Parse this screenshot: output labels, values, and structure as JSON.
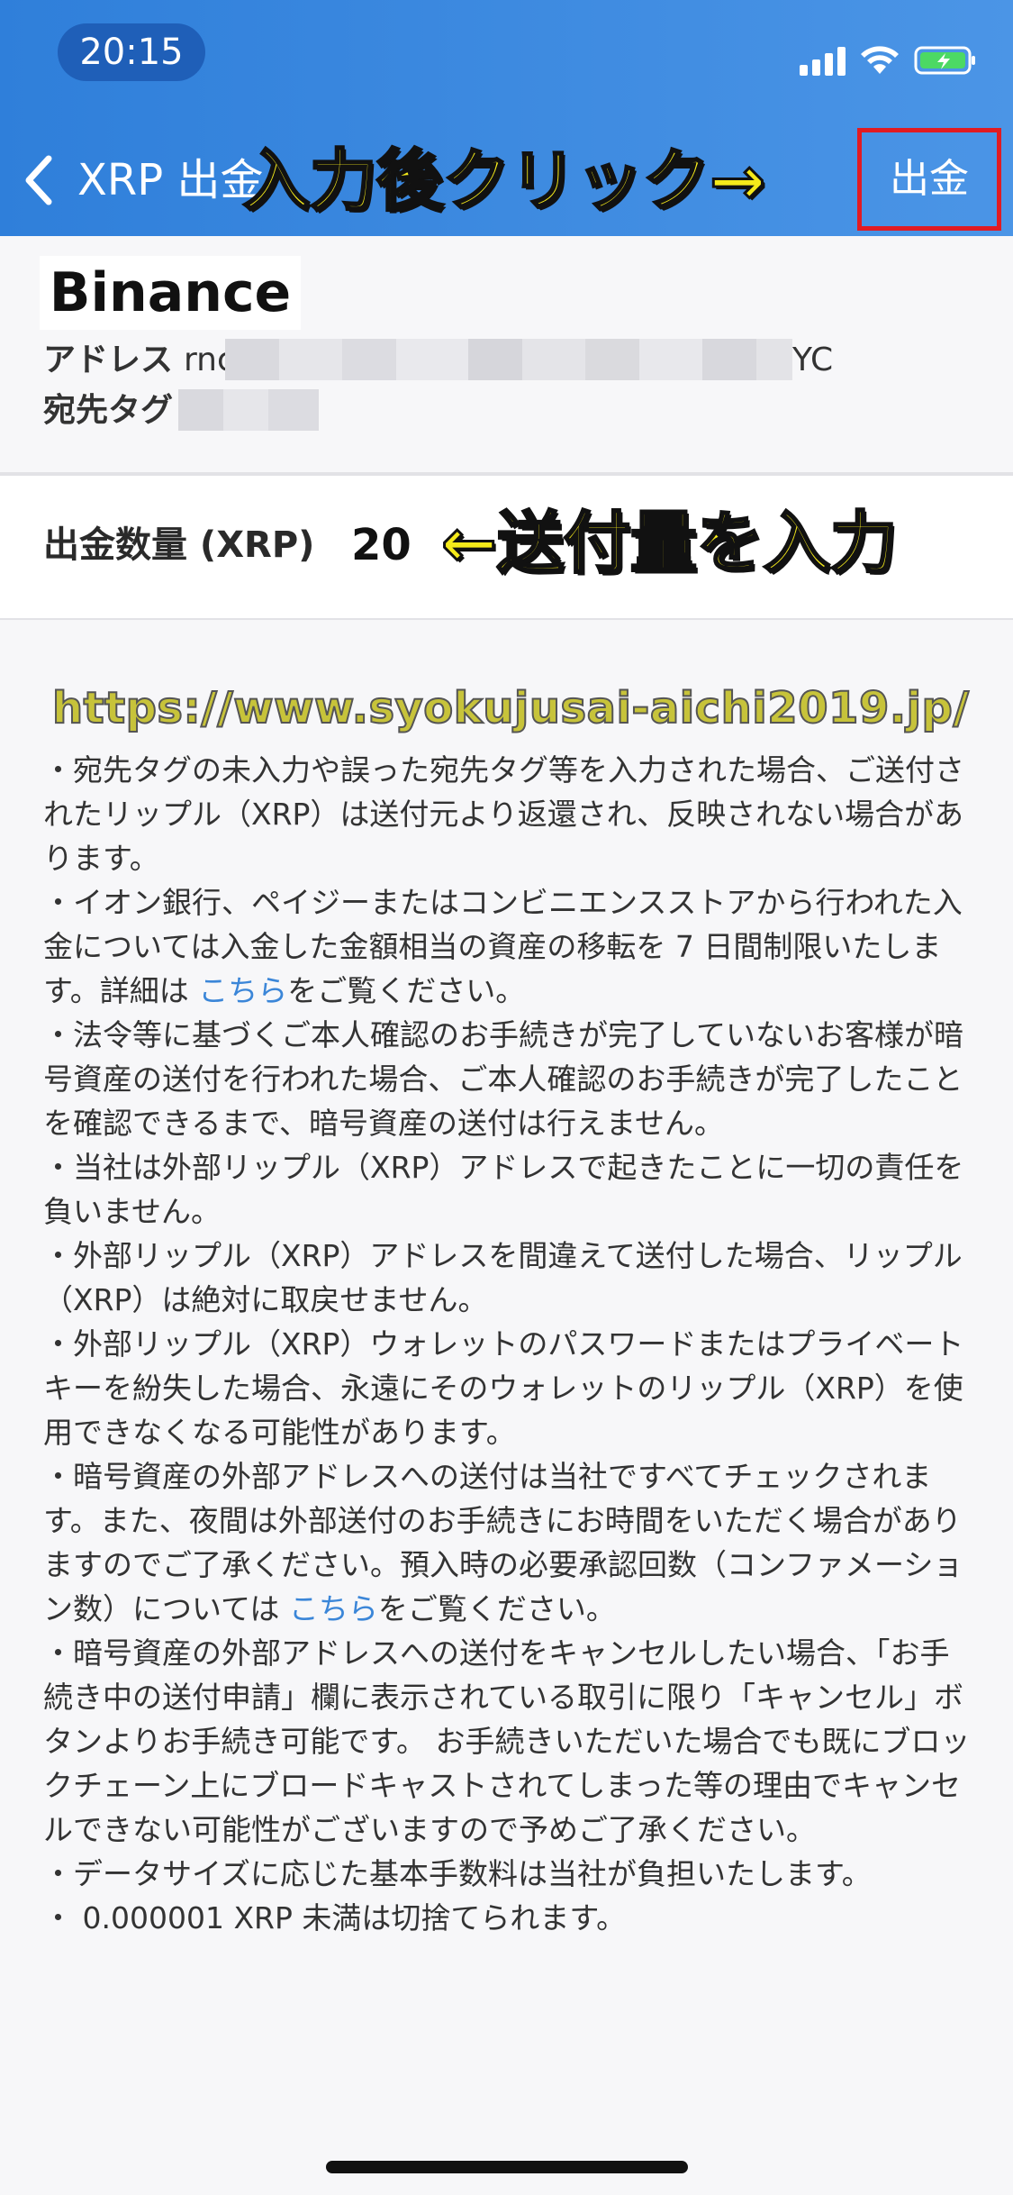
{
  "status_bar": {
    "time": "20:15"
  },
  "colors": {
    "header": "#2f7fda",
    "link": "#3b86d8",
    "highlight_box": "#e11b22",
    "overlay_text": "#f5ea1a"
  },
  "nav": {
    "back_icon": "chevron-left-icon",
    "title": "XRP 出金",
    "overlay_instruction": "入力後クリック→",
    "withdraw_label": "出金"
  },
  "destination": {
    "exchange_label": "Binance",
    "address_label": "アドレス",
    "address_prefix": "rnc",
    "address_suffix": "YC",
    "tag_label": "宛先タグ"
  },
  "amount": {
    "label": "出金数量 (XRP)",
    "value": "20",
    "overlay_instruction": "←送付量を入力"
  },
  "watermark": "https://www.syokujusai-aichi2019.jp/",
  "notes": [
    {
      "before": "・宛先タグの未入力や誤った宛先タグ等を入力された場合、ご送付されたリップル（XRP）は送付元より返還され、反映されない場合があります。"
    },
    {
      "before": "・イオン銀行、ペイジーまたはコンビニエンスストアから行われた入金については入金した金額相当の資産の移転を 7 日間制限いたします。詳細は ",
      "link": "こちら",
      "after": "をご覧ください。"
    },
    {
      "before": "・法令等に基づくご本人確認のお手続きが完了していないお客様が暗号資産の送付を行われた場合、ご本人確認のお手続きが完了したことを確認できるまで、暗号資産の送付は行えません。"
    },
    {
      "before": "・当社は外部リップル（XRP）アドレスで起きたことに一切の責任を負いません。"
    },
    {
      "before": "・外部リップル（XRP）アドレスを間違えて送付した場合、リップル（XRP）は絶対に取戻せません。"
    },
    {
      "before": "・外部リップル（XRP）ウォレットのパスワードまたはプライベートキーを紛失した場合、永遠にそのウォレットのリップル（XRP）を使用できなくなる可能性があります。"
    },
    {
      "before": "・暗号資産の外部アドレスへの送付は当社ですべてチェックされます。また、夜間は外部送付のお手続きにお時間をいただく場合がありますのでご了承ください。預入時の必要承認回数（コンファメーション数）については ",
      "link": "こちら",
      "after": "をご覧ください。"
    },
    {
      "before": "・暗号資産の外部アドレスへの送付をキャンセルしたい場合、「お手続き中の送付申請」欄に表示されている取引に限り「キャンセル」ボタンよりお手続き可能です。 お手続きいただいた場合でも既にブロックチェーン上にブロードキャストされてしまった等の理由でキャンセルできない可能性がございますので予めご了承ください。"
    },
    {
      "before": "・データサイズに応じた基本手数料は当社が負担いたします。"
    },
    {
      "before": "・ 0.000001 XRP 未満は切捨てられます。"
    }
  ]
}
